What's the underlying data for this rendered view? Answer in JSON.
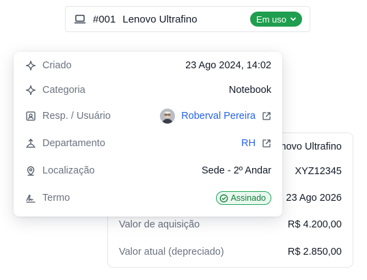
{
  "header": {
    "code": "#001",
    "name": "Lenovo Ultrafino",
    "status": "Em uso",
    "status_color": "#1e9e4e"
  },
  "details": {
    "created": {
      "label": "Criado",
      "value": "23 Ago 2024, 14:02"
    },
    "category": {
      "label": "Categoria",
      "value": "Notebook"
    },
    "responsible": {
      "label": "Resp. / Usuário",
      "value": "Roberval Pereira"
    },
    "department": {
      "label": "Departamento",
      "value": "RH"
    },
    "location": {
      "label": "Localização",
      "value": "Sede - 2º Andar"
    },
    "term": {
      "label": "Termo",
      "value": "Assinado"
    }
  },
  "back_card": {
    "model_partial": "novo Ultrafino",
    "serial_partial": "XYZ12345",
    "warranty_partial": "23 Ago 2026",
    "acquisition": {
      "label": "Valor de aquisição",
      "value": "R$ 4.200,00"
    },
    "current": {
      "label": "Valor atual (depreciado)",
      "value": "R$ 2.850,00"
    }
  },
  "colors": {
    "link": "#2563eb",
    "label": "#6b7280",
    "success": "#22a55a"
  }
}
